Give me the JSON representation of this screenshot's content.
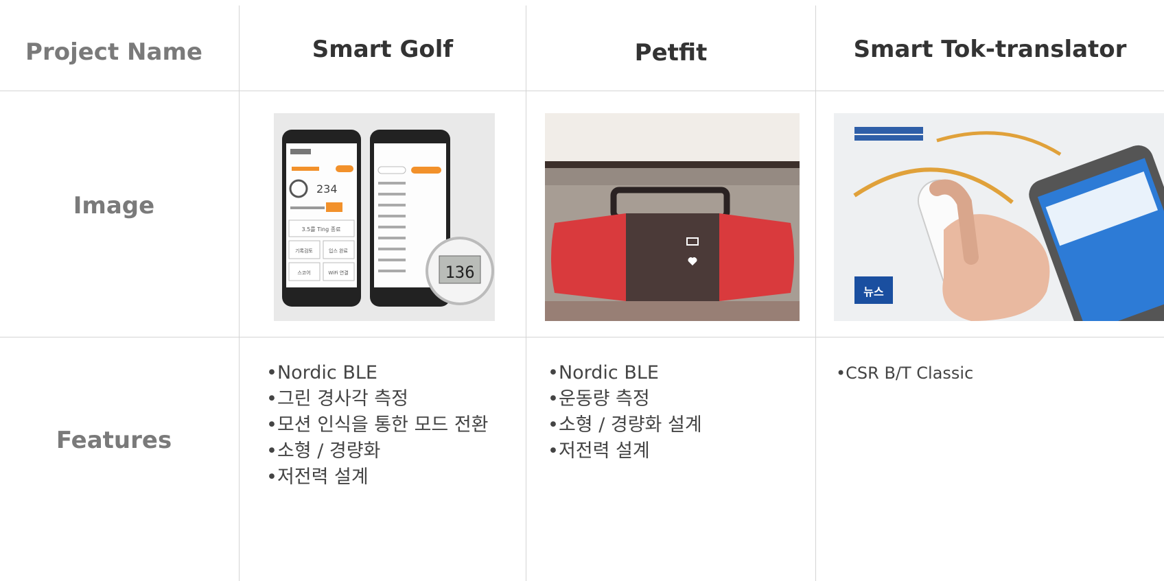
{
  "row_labels": {
    "project_name": "Project Name",
    "image": "Image",
    "features": "Features"
  },
  "projects": [
    {
      "name": "Smart Golf",
      "features": [
        "Nordic BLE",
        "그린 경사각 측정",
        "모션 인식을 통한 모드 전환",
        "소형 / 경량화",
        "저전력 설계"
      ],
      "image_text": {
        "watch_reading": "136",
        "stat_reading": "234",
        "menu_button": "3.5를 Ting 종료",
        "buttons": [
          "기록검토",
          "입스 완료",
          "스코어",
          "WiFi 연결"
        ]
      }
    },
    {
      "name": "Petfit",
      "features": [
        "Nordic BLE",
        "운동량 측정",
        "소형 / 경량화 설계",
        "저전력 설계"
      ]
    },
    {
      "name": "Smart Tok-translator",
      "features": [
        "CSR B/T Classic"
      ],
      "image_text": {
        "news_badge": "뉴스"
      }
    }
  ],
  "colors": {
    "grid": "#d4d4d4",
    "petfit_red": "#d93a3d",
    "petfit_body": "#4b3a38",
    "golf_accent": "#f2912b"
  }
}
